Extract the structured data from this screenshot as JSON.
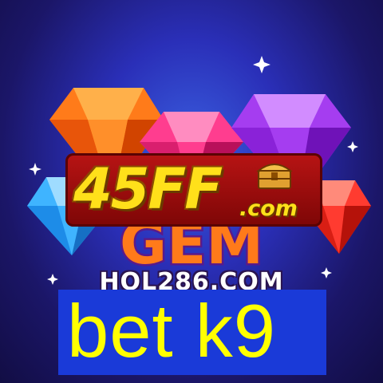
{
  "banner": {
    "logo_main": "45FF",
    "logo_suffix": ".com",
    "game_title": "GEM",
    "site_text": "HOL286.COM",
    "caption": "bet k9"
  },
  "icons": [
    "sparkle-icon",
    "gem-icon",
    "treasure-chest-icon"
  ],
  "colors": {
    "background": "#2a2fb8",
    "logo_band": "#b81414",
    "logo_text": "#ffe01a",
    "caption_box": "#1a3ad8",
    "caption_text": "#ffff00"
  }
}
